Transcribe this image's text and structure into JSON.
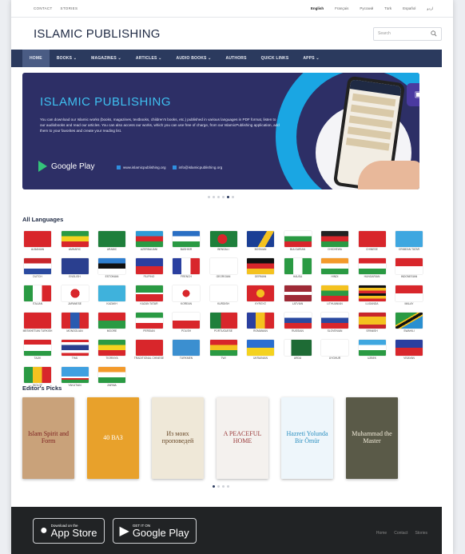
{
  "topbar": {
    "left": [
      "Contact",
      "Stories"
    ],
    "languages": [
      "English",
      "Français",
      "Русский",
      "Türk",
      "Español",
      "اردو"
    ]
  },
  "header": {
    "brand": "ISLAMIC PUBLISHING",
    "search_placeholder": "Search"
  },
  "nav": {
    "items": [
      "HOME",
      "BOOKS ⌄",
      "MAGAZINES ⌄",
      "ARTICLES ⌄",
      "AUDIO BOOKS ⌄",
      "AUTHORS",
      "QUICK LINKS",
      "APPS ⌄"
    ]
  },
  "banner": {
    "title": "ISLAMIC PUBLISHING",
    "text": "You can download our Islamic works (books, magazines, textbooks, children's books, etc.) published in various languages in PDF format, listen to our audiobooks and read our articles. You can also access our works, which you can use free of charge, from our IslamicPublishing application, add them to your favorites and create your reading list.",
    "store": "Google Play",
    "site": "www.islamicpublishing.org",
    "email": "info@islamicpublishing.org"
  },
  "sections": {
    "languages": "All Languages",
    "picks": "Editor's Picks"
  },
  "languages": [
    {
      "name": "Albanian",
      "flag": "linear-gradient(#d8262b,#d8262b)"
    },
    {
      "name": "Amharic",
      "flag": "linear-gradient(#2a9a43 0 33%,#f4d21f 33% 66%,#d8262b 66%)"
    },
    {
      "name": "Arabic",
      "flag": "linear-gradient(#1e7f3b,#1e7f3b)"
    },
    {
      "name": "Azerbaijani",
      "flag": "linear-gradient(#2f9bd6 0 33%,#d8262b 33% 66%,#2a9a43 66%)"
    },
    {
      "name": "Bashkir",
      "flag": "linear-gradient(#2a6fc4 0 33%,#fff 33% 66%,#2a9a43 66%)"
    },
    {
      "name": "Bengali",
      "flag": "radial-gradient(circle at 45% 50%,#d8262b 0 28%,#1e7f3b 29%)"
    },
    {
      "name": "Bosnian",
      "flag": "linear-gradient(120deg,#1b3f95 0 55%,#f4c21f 55% 75%,#1b3f95 75%)"
    },
    {
      "name": "Bulgarian",
      "flag": "linear-gradient(#fff 0 33%,#2a9a43 33% 66%,#d8262b 66%)"
    },
    {
      "name": "Chichewa",
      "flag": "linear-gradient(#222 0 33%,#d8262b 33% 66%,#2a9a43 66%)"
    },
    {
      "name": "Chinese",
      "flag": "linear-gradient(#d8262b,#d8262b)"
    },
    {
      "name": "Crimean Tatar",
      "flag": "linear-gradient(#3fa7e0,#3fa7e0)"
    },
    {
      "name": "Dutch",
      "flag": "linear-gradient(#c8262b 0 33%,#fff 33% 66%,#2a4aa0 66%)"
    },
    {
      "name": "English",
      "flag": "linear-gradient(#2a3f8f,#2a3f8f)"
    },
    {
      "name": "Estonian",
      "flag": "linear-gradient(#2f7fd0 0 33%,#111 33% 66%,#fff 66%)"
    },
    {
      "name": "Filipino",
      "flag": "linear-gradient(#2a3f9f 0 50%,#d8262b 50%)"
    },
    {
      "name": "French",
      "flag": "linear-gradient(90deg,#2a3f9f 0 33%,#fff 33% 66%,#d8262b 66%)"
    },
    {
      "name": "Georgian",
      "flag": "linear-gradient(#fff,#fff)"
    },
    {
      "name": "German",
      "flag": "linear-gradient(#111 0 33%,#d8262b 33% 66%,#f4c21f 66%)"
    },
    {
      "name": "Hausa",
      "flag": "linear-gradient(90deg,#2a9a43 0 33%,#fff 33% 66%,#2a9a43 66%)"
    },
    {
      "name": "Hindi",
      "flag": "linear-gradient(#f39a2b 0 33%,#fff 33% 66%,#2a9a43 66%)"
    },
    {
      "name": "Hungarian",
      "flag": "linear-gradient(#d8262b 0 33%,#fff 33% 66%,#2a9a43 66%)"
    },
    {
      "name": "Indonesian",
      "flag": "linear-gradient(#d8262b 0 50%,#fff 50%)"
    },
    {
      "name": "Italian",
      "flag": "linear-gradient(90deg,#2a9a43 0 33%,#fff 33% 66%,#d8262b 66%)"
    },
    {
      "name": "Japanese",
      "flag": "radial-gradient(circle,#d8262b 0 28%,#fff 29%)"
    },
    {
      "name": "Kazakh",
      "flag": "linear-gradient(#3fb2dc,#3fb2dc)"
    },
    {
      "name": "Kazan Tatar",
      "flag": "linear-gradient(#2a9a43 0 45%,#fff 45% 55%,#d8262b 55%)"
    },
    {
      "name": "Korean",
      "flag": "radial-gradient(circle,#d8262b 0 22%,#fff 23%)"
    },
    {
      "name": "Kurdish",
      "flag": "linear-gradient(#fff,#fff)"
    },
    {
      "name": "Kyrgyz",
      "flag": "radial-gradient(circle,#f4c21f 0 25%,#d8262b 26%)"
    },
    {
      "name": "Latvian",
      "flag": "linear-gradient(#9e2a36 0 40%,#fff 40% 60%,#9e2a36 60%)"
    },
    {
      "name": "Lithuanian",
      "flag": "linear-gradient(#f4c21f 0 33%,#2a9a43 33% 66%,#d8262b 66%)"
    },
    {
      "name": "Luganda",
      "flag": "linear-gradient(#111 0 16%,#f4c21f 16% 33%,#d8262b 33% 50%,#111 50% 66%,#f4c21f 66% 83%,#d8262b 83%)"
    },
    {
      "name": "Malay",
      "flag": "linear-gradient(#d8262b 0 50%,#fff 50%)"
    },
    {
      "name": "Meskhetian Turkish",
      "flag": "linear-gradient(#d8262b,#d8262b)"
    },
    {
      "name": "Mongolian",
      "flag": "linear-gradient(90deg,#d8262b 0 33%,#2a5ab0 33% 66%,#d8262b 66%)"
    },
    {
      "name": "Moore",
      "flag": "linear-gradient(#d8262b 0 50%,#2a9a43 50%)"
    },
    {
      "name": "Persian",
      "flag": "linear-gradient(#2a9a43 0 33%,#fff 33% 66%,#d8262b 66%)"
    },
    {
      "name": "Polish",
      "flag": "linear-gradient(#fff 0 50%,#d8262b 50%)"
    },
    {
      "name": "Portuguese",
      "flag": "linear-gradient(90deg,#1e7f3b 0 40%,#d8262b 40%)"
    },
    {
      "name": "Romanian",
      "flag": "linear-gradient(90deg,#2a3f9f 0 33%,#f4c21f 33% 66%,#d8262b 66%)"
    },
    {
      "name": "Russian",
      "flag": "linear-gradient(#fff 0 33%,#2a4aa0 33% 66%,#d8262b 66%)"
    },
    {
      "name": "Slovenian",
      "flag": "linear-gradient(#fff 0 33%,#2a4aa0 33% 66%,#d8262b 66%)"
    },
    {
      "name": "Spanish",
      "flag": "linear-gradient(#c8262b 0 25%,#f4c21f 25% 75%,#c8262b 75%)"
    },
    {
      "name": "Swahili",
      "flag": "linear-gradient(150deg,#2a9a43 0 40%,#f4c21f 40% 45%,#111 45% 55%,#f4c21f 55% 60%,#2a8fd0 60%)"
    },
    {
      "name": "Tajik",
      "flag": "linear-gradient(#d8262b 0 30%,#fff 30% 70%,#2a9a43 70%)"
    },
    {
      "name": "Thai",
      "flag": "linear-gradient(#d8262b 0 16%,#fff 16% 33%,#2a3f8f 33% 66%,#fff 66% 83%,#d8262b 83%)"
    },
    {
      "name": "Tigrinya",
      "flag": "linear-gradient(#2a9a43 0 33%,#f4d21f 33% 66%,#d8262b 66%)"
    },
    {
      "name": "Traditional Chinese",
      "flag": "linear-gradient(#d8262b,#d8262b)"
    },
    {
      "name": "Turkmen",
      "flag": "linear-gradient(#3b8fd0,#3b8fd0)"
    },
    {
      "name": "Twi",
      "flag": "linear-gradient(#d8262b 0 33%,#f4c21f 33% 66%,#2a9a43 66%)"
    },
    {
      "name": "Ukrainian",
      "flag": "linear-gradient(#2a6fd0 0 50%,#f4d21f 50%)"
    },
    {
      "name": "Urdu",
      "flag": "linear-gradient(90deg,#fff 0 25%,#1e6b35 25%)"
    },
    {
      "name": "Uyghur",
      "flag": "linear-gradient(#fff,#fff)"
    },
    {
      "name": "Uzbek",
      "flag": "linear-gradient(#3fa7e0 0 33%,#fff 33% 66%,#2a9a43 66%)"
    },
    {
      "name": "Visayan",
      "flag": "linear-gradient(#2a3f9f 0 50%,#d8262b 50%)"
    },
    {
      "name": "Wolof",
      "flag": "linear-gradient(90deg,#2a9a43 0 33%,#f4c21f 33% 66%,#d8262b 66%)"
    },
    {
      "name": "Yakutian",
      "flag": "linear-gradient(#3fa0e0 0 60%,#fff 60% 70%,#d8262b 70% 80%,#2a9a43 80%)"
    },
    {
      "name": "Zarma",
      "flag": "linear-gradient(#f39a2b 0 33%,#fff 33% 66%,#2a9a43 66%)"
    }
  ],
  "books": [
    {
      "title": "Islam Spirit and Form",
      "bg": "#c9a27a",
      "fg": "#7a1d1d"
    },
    {
      "title": "40 ВАЗ",
      "bg": "#e8a12b",
      "fg": "#ffffff"
    },
    {
      "title": "Из моих проповедей",
      "bg": "#efe8d8",
      "fg": "#6a4a2a"
    },
    {
      "title": "A PEACEFUL HOME",
      "bg": "#f4f1ee",
      "fg": "#9a3a3a"
    },
    {
      "title": "Hazreti Yolunda Bir Ömür",
      "bg": "#eef6fb",
      "fg": "#2a8fc0"
    },
    {
      "title": "Muhammad the Master",
      "bg": "#5a5a48",
      "fg": "#f0ead8"
    }
  ],
  "footer": {
    "app_store_small": "Download on the",
    "app_store_big": "App Store",
    "gp_small": "GET IT ON",
    "gp_big": "Google Play",
    "links": [
      "Home",
      "Contact",
      "Stories"
    ]
  }
}
